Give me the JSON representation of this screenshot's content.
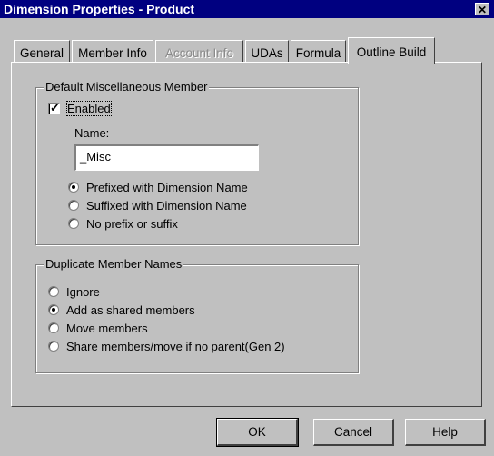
{
  "window": {
    "title": "Dimension Properties - Product",
    "close_label": "✕"
  },
  "tabs": [
    {
      "label": "General",
      "disabled": false,
      "active": false
    },
    {
      "label": "Member Info",
      "disabled": false,
      "active": false
    },
    {
      "label": "Account Info",
      "disabled": true,
      "active": false
    },
    {
      "label": "UDAs",
      "disabled": false,
      "active": false
    },
    {
      "label": "Formula",
      "disabled": false,
      "active": false
    },
    {
      "label": "Outline Build",
      "disabled": false,
      "active": true
    }
  ],
  "misc_group": {
    "title": "Default Miscellaneous Member",
    "enabled_label": "Enabled",
    "enabled_checked": true,
    "name_label": "Name:",
    "name_value": "_Misc",
    "options": [
      {
        "label": "Prefixed with Dimension Name",
        "accel": "P",
        "selected": true
      },
      {
        "label": "Suffixed with Dimension Name",
        "accel": "S",
        "selected": false
      },
      {
        "label": "No prefix or suffix",
        "accel": "N",
        "selected": false
      }
    ]
  },
  "dup_group": {
    "title": "Duplicate Member Names",
    "options": [
      {
        "label": "Ignore",
        "accel": "I",
        "selected": false
      },
      {
        "label": "Add as shared members",
        "accel": "A",
        "selected": true
      },
      {
        "label": "Move members",
        "accel": "M",
        "selected": false
      },
      {
        "label": "Share members/move if no parent(Gen 2)",
        "accel": "h",
        "selected": false
      }
    ]
  },
  "buttons": {
    "ok": "OK",
    "cancel": "Cancel",
    "help": "Help"
  }
}
